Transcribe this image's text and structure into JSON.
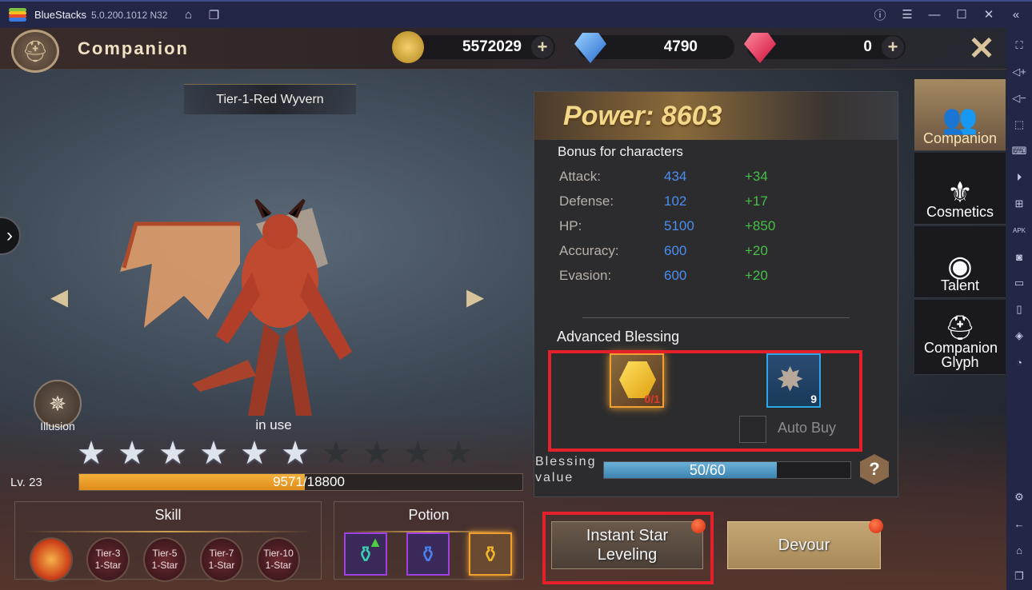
{
  "window": {
    "app_name": "BlueStacks",
    "version": "5.0.200.1012 N32",
    "icons": [
      "home-icon",
      "multi-instance-icon",
      "help-icon",
      "menu-icon",
      "minimize-icon",
      "maximize-icon",
      "close-icon",
      "collapse-sidebar-icon"
    ]
  },
  "side_toolbar": {
    "top_icons": [
      "fullscreen-icon",
      "volume-up-icon",
      "volume-down-icon",
      "pointer-icon",
      "keyboard-icon",
      "macro-record-icon",
      "gamepad-controls-icon",
      "install-apk-icon",
      "screenshot-icon",
      "folder-icon",
      "rotate-icon",
      "multi-instance-stack-icon",
      "performance-icon"
    ],
    "bottom_icons": [
      "settings-icon",
      "back-icon",
      "home-icon",
      "recent-apps-icon"
    ]
  },
  "header": {
    "title": "Companion",
    "currencies": [
      {
        "name": "gold",
        "value": "5572029",
        "has_plus": true
      },
      {
        "name": "locked-diamond",
        "value": "4790",
        "has_plus": false
      },
      {
        "name": "ruby",
        "value": "0",
        "has_plus": true
      }
    ]
  },
  "companion": {
    "name": "Tier-1-Red Wyvern",
    "illusion_label": "Illusion",
    "status": "in use",
    "stars_filled": 6,
    "stars_total": 10,
    "level_label": "Lv. 23",
    "xp_current": 9571,
    "xp_max": 18800,
    "xp_text": "9571/18800"
  },
  "skill_panel": {
    "title": "Skill",
    "skills": [
      {
        "label": "",
        "type": "fire"
      },
      {
        "label": "Tier-3\n1-Star"
      },
      {
        "label": "Tier-5\n1-Star"
      },
      {
        "label": "Tier-7\n1-Star"
      },
      {
        "label": "Tier-10\n1-Star"
      }
    ]
  },
  "potion_panel": {
    "title": "Potion",
    "potions": [
      {
        "color": "teal",
        "upgrade_arrow": true
      },
      {
        "color": "blue",
        "upgrade_arrow": false
      },
      {
        "color": "gold",
        "upgrade_arrow": false
      }
    ]
  },
  "power_panel": {
    "power_text": "Power: 8603",
    "bonus_title": "Bonus for characters",
    "stats": [
      {
        "label": "Attack:",
        "value": "434",
        "increase": "+34"
      },
      {
        "label": "Defense:",
        "value": "102",
        "increase": "+17"
      },
      {
        "label": "HP:",
        "value": "5100",
        "increase": "+850"
      },
      {
        "label": "Accuracy:",
        "value": "600",
        "increase": "+20"
      },
      {
        "label": "Evasion:",
        "value": "600",
        "increase": "+20"
      }
    ],
    "advanced_blessing_title": "Advanced Blessing",
    "blessing_items": [
      {
        "name": "yellow-gem",
        "count": "0/1"
      },
      {
        "name": "star-stone",
        "count": "9"
      }
    ],
    "auto_buy_label": "Auto Buy",
    "blessing_label": "Blessing value",
    "blessing_current": 50,
    "blessing_max": 60,
    "blessing_text": "50/60",
    "help_label": "?"
  },
  "buttons": {
    "instant_star_leveling": "Instant Star Leveling",
    "devour": "Devour"
  },
  "right_tabs": [
    {
      "label": "Companion",
      "active": true
    },
    {
      "label": "Cosmetics",
      "active": false
    },
    {
      "label": "Talent",
      "active": false
    },
    {
      "label": "Companion Glyph",
      "active": false
    }
  ],
  "colors": {
    "stat_value": "#4b8ef0",
    "stat_increase": "#46c046",
    "highlight_box": "#e4202a",
    "xp_fill": "#f0a030",
    "blessing_fill": "#5aa0cc"
  }
}
